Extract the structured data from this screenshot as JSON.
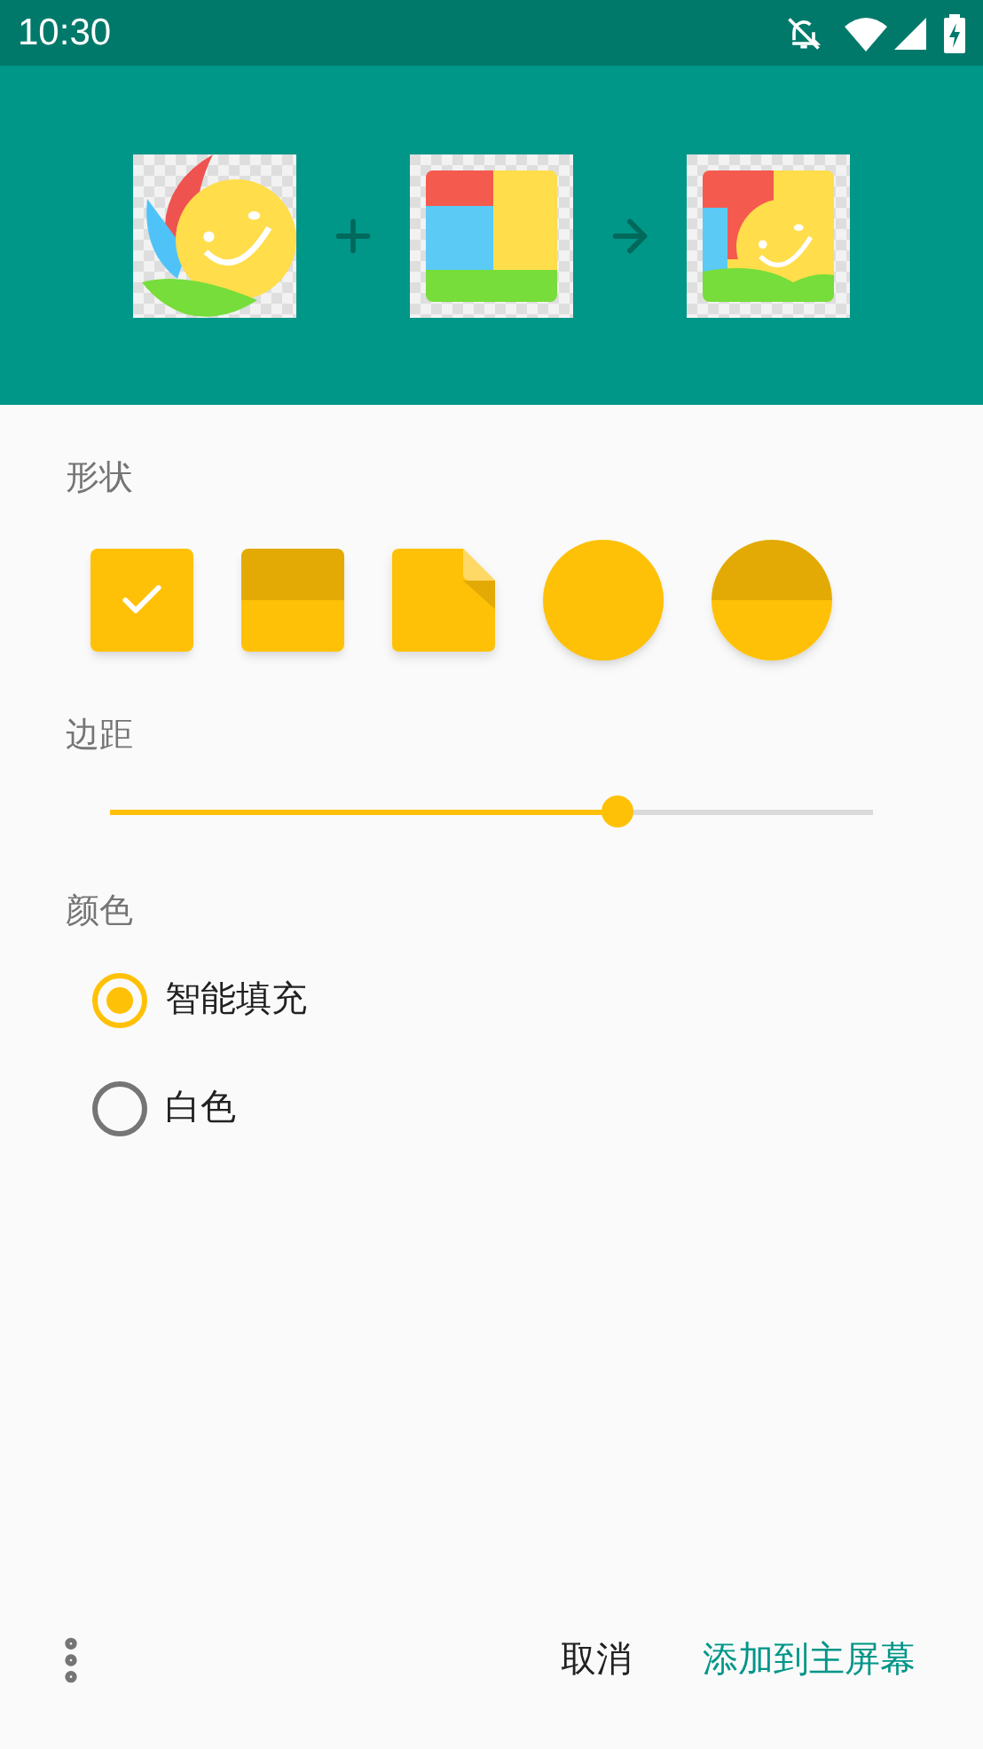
{
  "status_bar": {
    "time": "10:30"
  },
  "shape_section": {
    "label": "形状",
    "shapes": [
      {
        "kind": "square",
        "selected": true
      },
      {
        "kind": "split-square",
        "selected": false
      },
      {
        "kind": "folded-square",
        "selected": false
      },
      {
        "kind": "circle",
        "selected": false
      },
      {
        "kind": "split-circle",
        "selected": false
      }
    ]
  },
  "margin_section": {
    "label": "边距",
    "slider": {
      "level": 0.665
    }
  },
  "color_section": {
    "label": "颜色",
    "options": [
      {
        "label": "智能填充",
        "selected": true
      },
      {
        "label": "白色",
        "selected": false
      }
    ]
  },
  "footer": {
    "buttons": [
      "取消",
      "添加到主屏幕"
    ]
  }
}
